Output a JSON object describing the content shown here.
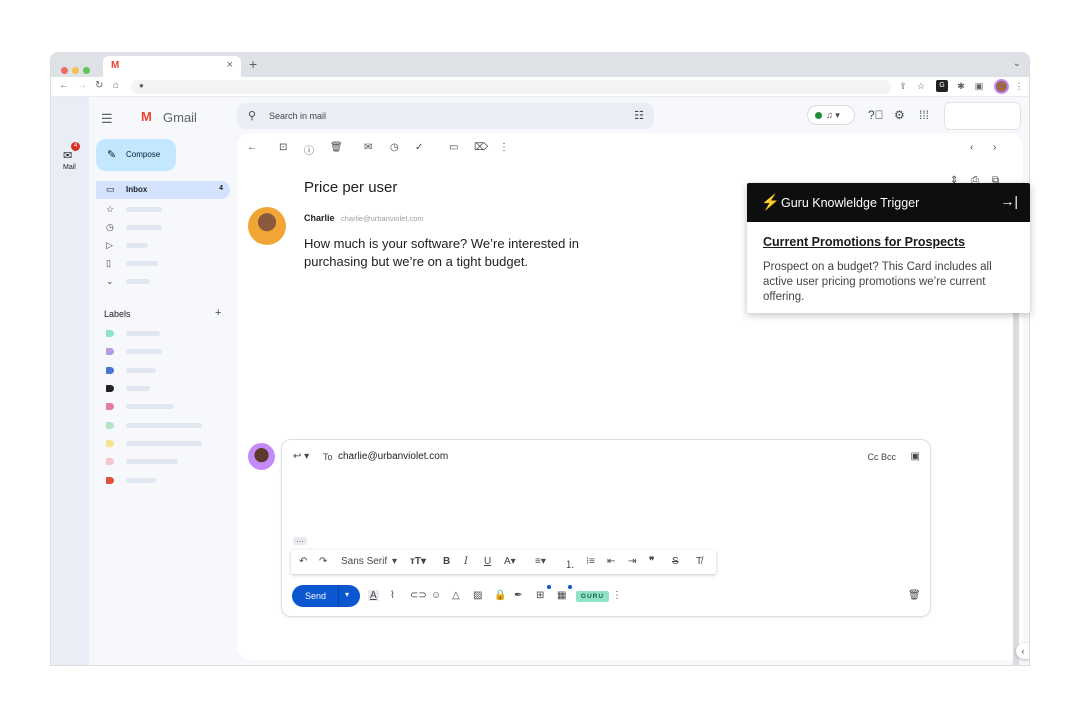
{
  "browser": {
    "tab_favicon": "M",
    "tab_close": "×",
    "new_tab": "+",
    "tab_chevron": "⌄"
  },
  "app": {
    "name": "Gmail",
    "logo": "M",
    "compose_label": "Compose",
    "inbox_label": "Inbox",
    "inbox_count": "4",
    "labels_heading": "Labels",
    "labels_add": "+",
    "rail_mail_label": "Mail",
    "rail_badge": "4"
  },
  "search": {
    "placeholder": "Search in mail"
  },
  "email": {
    "subject": "Price per user",
    "sender_name": "Charlie",
    "sender_email": "charlie@urbanviolet.com",
    "body": "How much is your software? We’re interested in purchasing but we’re on a tight budget."
  },
  "reply": {
    "to_label": "To",
    "to_address": "charlie@urbanviolet.com",
    "cc_bcc": "Cc Bcc",
    "font_name": "Sans Serif",
    "send_label": "Send",
    "guru_button": "GURU"
  },
  "guru": {
    "header_title": "Guru Knowleldge Trigger",
    "card_title": "Current Promotions for Prospects",
    "card_body": "Prospect on a budget? This Card includes all active user pricing promotions we’re current offering."
  },
  "colors": {
    "compose_bg": "#c2e7ff",
    "inbox_bg": "#d3e3fd",
    "send_bg": "#0b57d0",
    "guru_header_bg": "#0e0e0e",
    "guru_bolt": "#f5b83d",
    "status_green": "#1e8e3e"
  },
  "label_colors": [
    "#8ee3c8",
    "#b39ddb",
    "#4a74d4",
    "#202124",
    "#e57e9c",
    "#b7e4c7",
    "#f6e58d",
    "#f3c6d0",
    "#e0513c"
  ]
}
